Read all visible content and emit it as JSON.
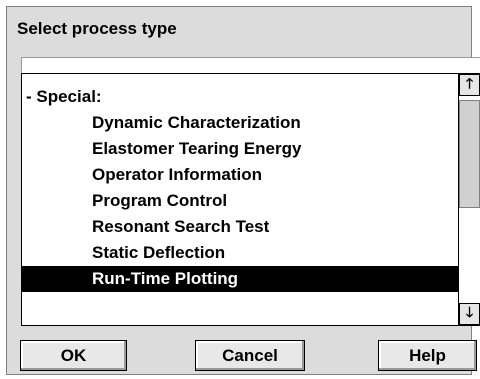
{
  "dialog": {
    "title": "Select process type"
  },
  "list": {
    "group_label": "- Special:",
    "items": [
      {
        "label": "Dynamic Characterization",
        "selected": false
      },
      {
        "label": "Elastomer Tearing Energy",
        "selected": false
      },
      {
        "label": "Operator Information",
        "selected": false
      },
      {
        "label": "Program Control",
        "selected": false
      },
      {
        "label": "Resonant Search Test",
        "selected": false
      },
      {
        "label": "Static Deflection",
        "selected": false
      },
      {
        "label": "Run-Time Plotting",
        "selected": true
      }
    ]
  },
  "scrollbar": {
    "up_icon": "up-arrow-icon",
    "up_glyph": "🡑",
    "down_icon": "down-arrow-icon",
    "down_glyph": "🡓"
  },
  "buttons": {
    "ok_label": "OK",
    "cancel_label": "Cancel",
    "help_label": "Help"
  },
  "colors": {
    "selection_bg": "#000000",
    "selection_fg": "#ffffff",
    "dialog_bg": "#dcdcdc"
  }
}
